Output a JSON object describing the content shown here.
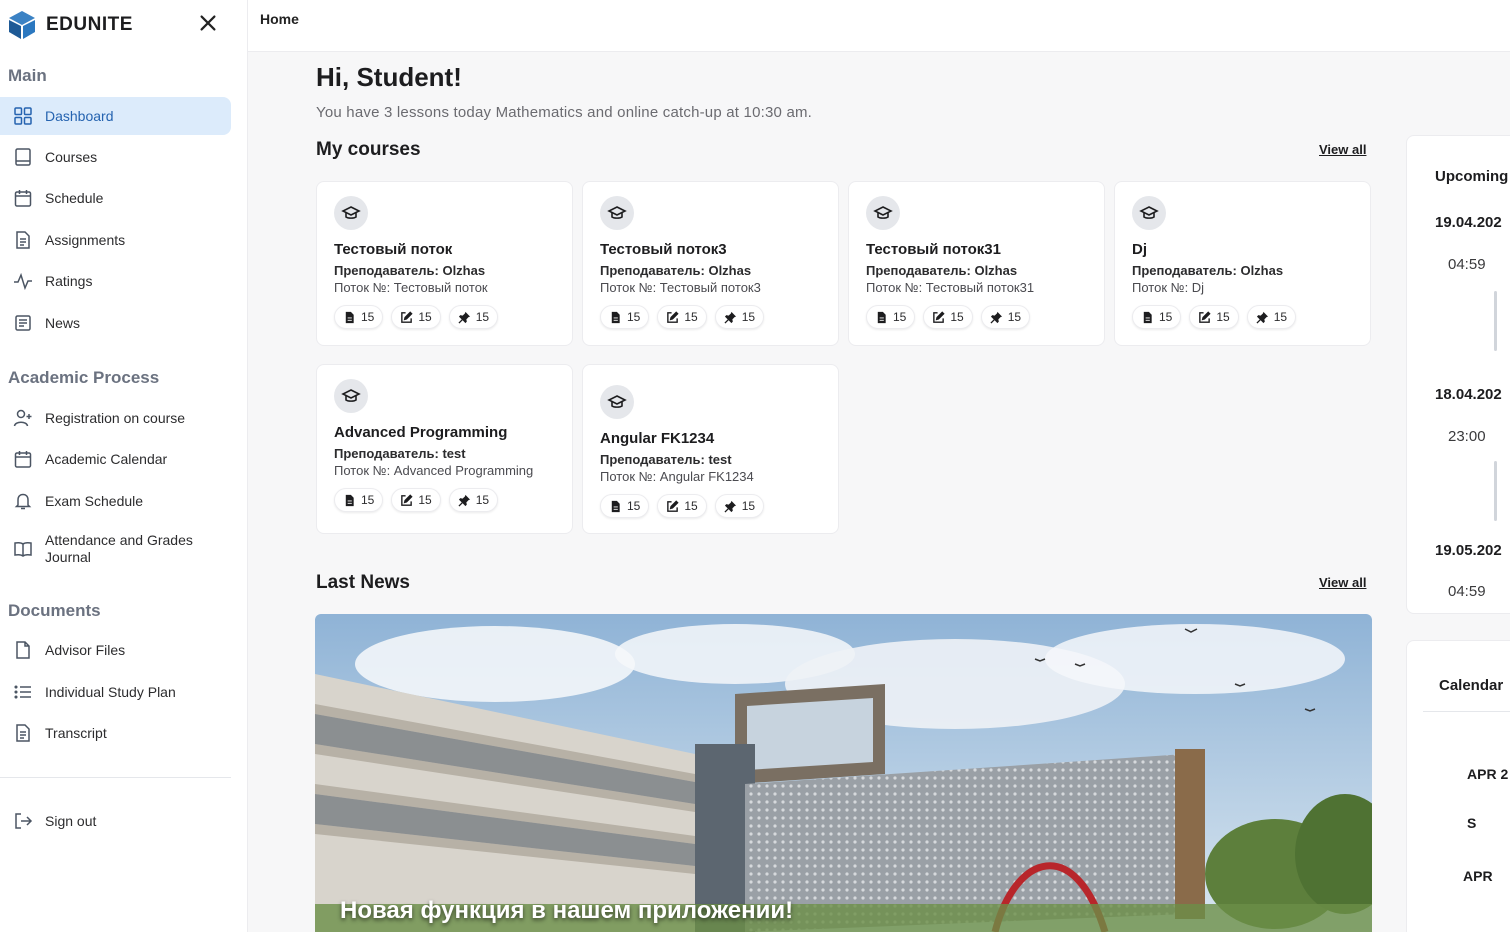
{
  "app": {
    "name": "EDUNITE"
  },
  "sidebar": {
    "sections": {
      "main": "Main",
      "academic": "Academic Process",
      "documents": "Documents"
    },
    "items": [
      {
        "label": "Dashboard",
        "icon": "dashboard-icon",
        "active": true
      },
      {
        "label": "Courses",
        "icon": "book-icon"
      },
      {
        "label": "Schedule",
        "icon": "calendar-icon"
      },
      {
        "label": "Assignments",
        "icon": "document-icon"
      },
      {
        "label": "Ratings",
        "icon": "activity-icon"
      },
      {
        "label": "News",
        "icon": "newspaper-icon"
      },
      {
        "label": "Registration on course",
        "icon": "user-plus-icon"
      },
      {
        "label": "Academic Calendar",
        "icon": "calendar-icon"
      },
      {
        "label": "Exam Schedule",
        "icon": "bell-icon"
      },
      {
        "label": "Attendance and Grades Journal",
        "icon": "open-book-icon"
      },
      {
        "label": "Advisor Files",
        "icon": "file-icon"
      },
      {
        "label": "Individual Study Plan",
        "icon": "list-icon"
      },
      {
        "label": "Transcript",
        "icon": "document-icon"
      }
    ],
    "signout": "Sign out"
  },
  "header": {
    "breadcrumb": "Home"
  },
  "main": {
    "greeting": "Hi, Student!",
    "subtitle": "You have 3 lessons today Mathematics and online catch-up at 10:30 am.",
    "courses_title": "My courses",
    "view_all": "View all",
    "courses": [
      {
        "title": "Тестовый поток",
        "teacher": "Преподаватель: Olzhas",
        "stream": "Поток №: Тестовый поток",
        "files": "15",
        "tasks": "15",
        "pins": "15"
      },
      {
        "title": "Тестовый поток3",
        "teacher": "Преподаватель: Olzhas",
        "stream": "Поток №: Тестовый поток3",
        "files": "15",
        "tasks": "15",
        "pins": "15"
      },
      {
        "title": "Тестовый поток31",
        "teacher": "Преподаватель: Olzhas",
        "stream": "Поток №: Тестовый поток31",
        "files": "15",
        "tasks": "15",
        "pins": "15"
      },
      {
        "title": "Dj",
        "teacher": "Преподаватель: Olzhas",
        "stream": "Поток №: Dj",
        "files": "15",
        "tasks": "15",
        "pins": "15"
      },
      {
        "title": "Advanced Programming",
        "teacher": "Преподаватель: test",
        "stream": "Поток №: Advanced Programming",
        "files": "15",
        "tasks": "15",
        "pins": "15"
      },
      {
        "title": "Angular FK1234",
        "teacher": "Преподаватель: test",
        "stream": "Поток №: Angular FK1234",
        "files": "15",
        "tasks": "15",
        "pins": "15"
      }
    ],
    "news_title": "Last News",
    "news_view_all": "View all",
    "news_headline": "Новая функция в нашем приложении!"
  },
  "upcoming": {
    "title": "Upcoming",
    "events": [
      {
        "date": "19.04.202",
        "time": "04:59"
      },
      {
        "date": "18.04.202",
        "time": "23:00"
      },
      {
        "date": "19.05.202",
        "time": "04:59"
      }
    ]
  },
  "calendar": {
    "title": "Calendar",
    "month": "APR 2",
    "day": "S",
    "month_short": "APR"
  },
  "colors": {
    "accent": "#2563b0",
    "active_bg": "#dcebfb",
    "logo_blue": "#1e6bb8"
  }
}
